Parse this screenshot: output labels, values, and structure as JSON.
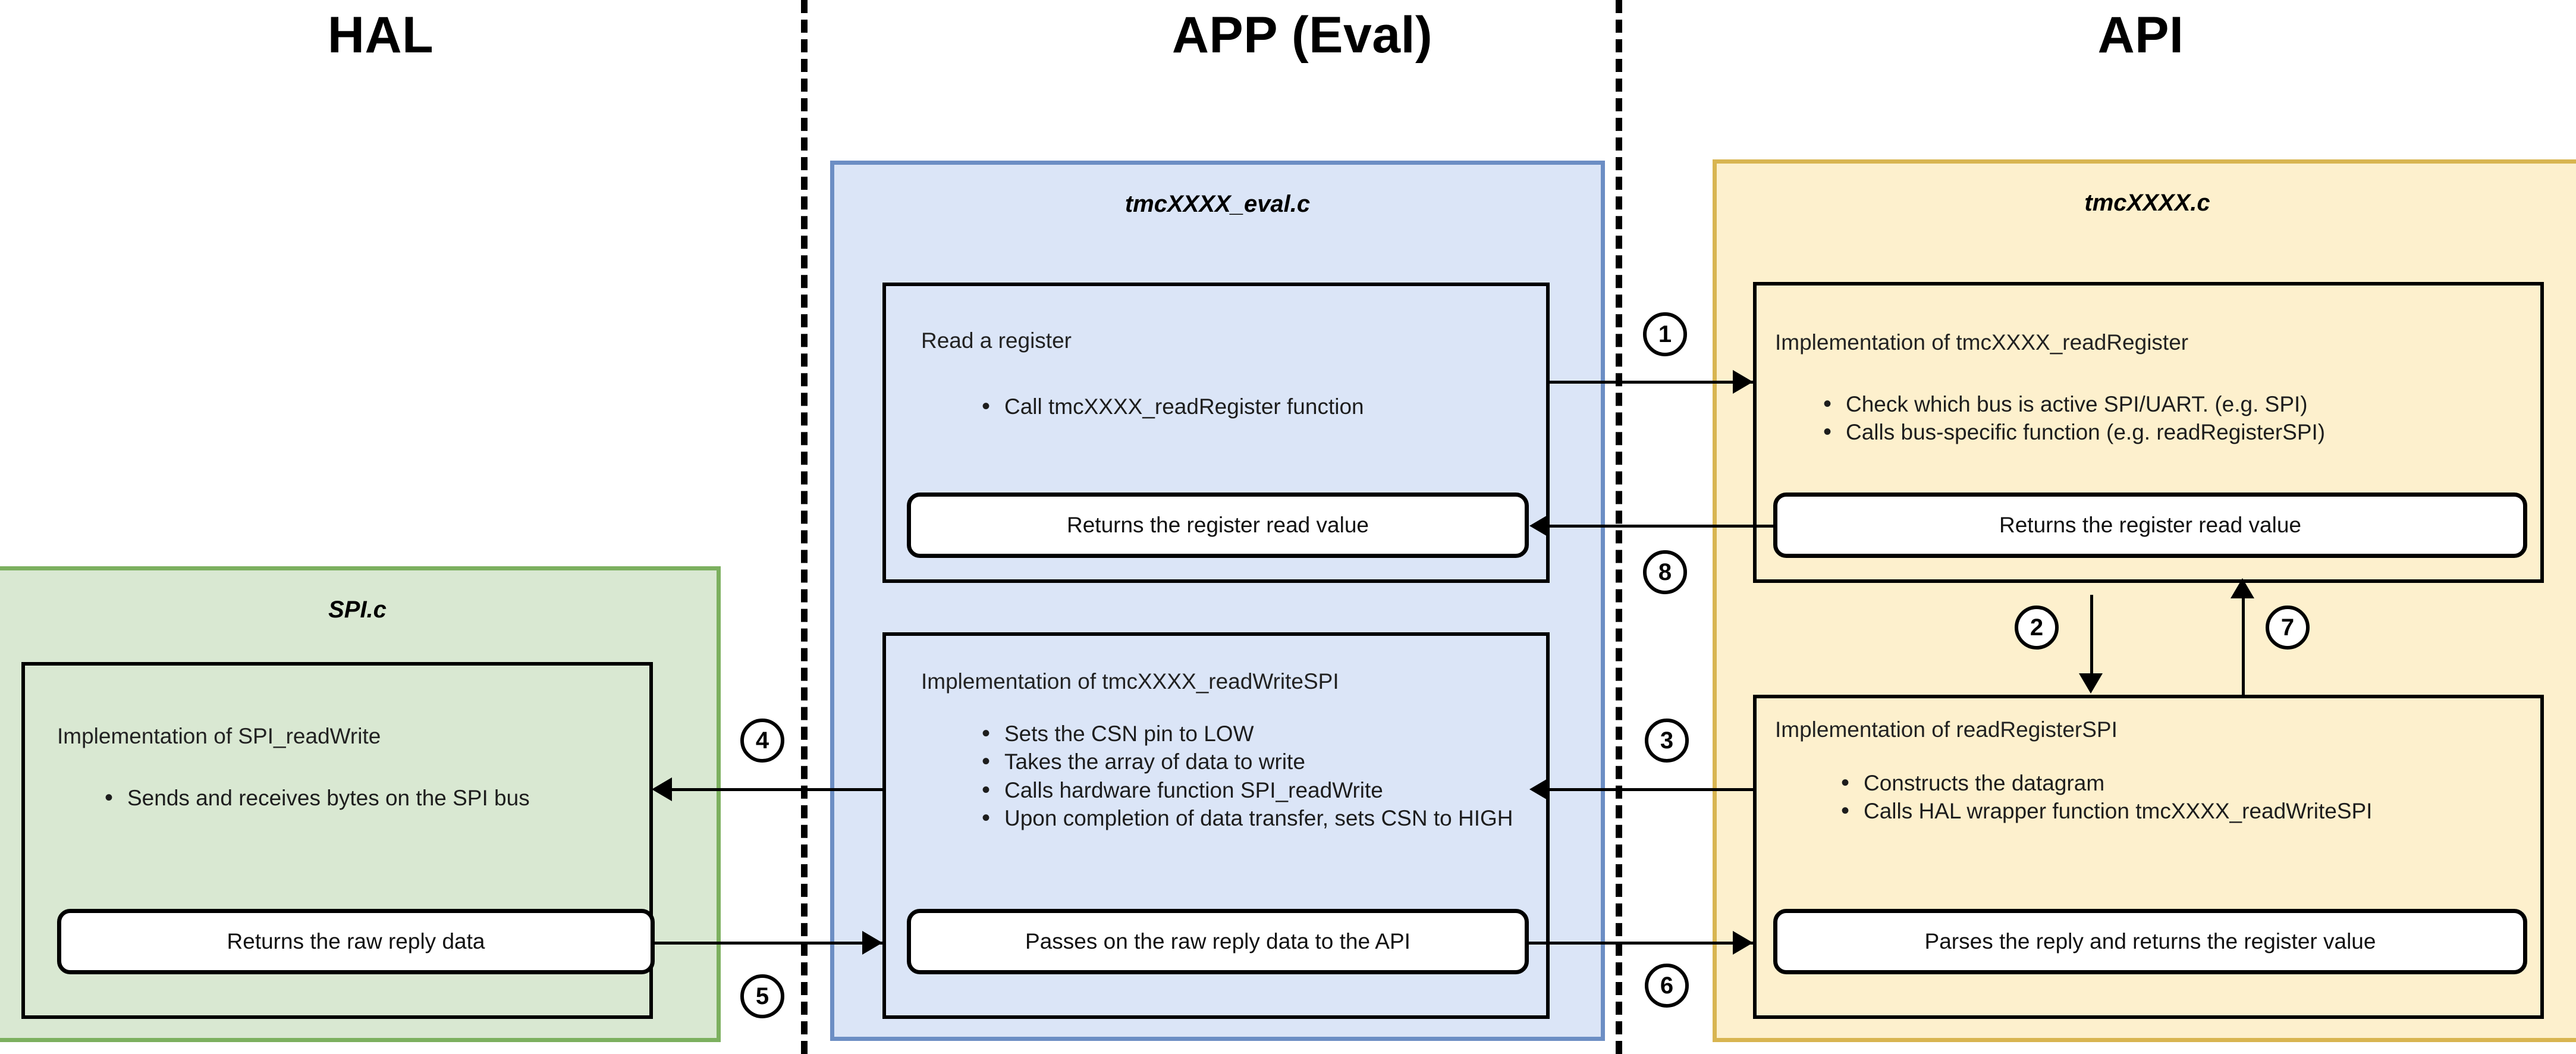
{
  "columns": [
    {
      "id": "hal",
      "title": "HAL"
    },
    {
      "id": "app",
      "title": "APP (Eval)"
    },
    {
      "id": "api",
      "title": "API"
    }
  ],
  "panels": {
    "app_eval": {
      "title": "tmcXXXX_eval.c",
      "color": "#dbe5f7",
      "border_color": "#6c8ec4"
    },
    "hal_spi": {
      "title": "SPI.c",
      "color": "#d9e8d2",
      "border_color": "#7cb05f"
    },
    "api_tmc": {
      "title": "tmcXXXX.c",
      "color": "#fdf0cd",
      "border_color": "#d8b551"
    }
  },
  "boxes": {
    "read_a_register": {
      "heading": "Read a register",
      "bullets": [
        "Call tmcXXXX_readRegister function"
      ],
      "pill": "Returns the register read value"
    },
    "tmc_readregister": {
      "heading": "Implementation of tmcXXXX_readRegister",
      "bullets": [
        "Check which bus is active SPI/UART. (e.g. SPI)",
        "Calls bus-specific function (e.g. readRegisterSPI)"
      ],
      "pill": "Returns the register read value"
    },
    "spi_readwrite": {
      "heading": "Implementation of SPI_readWrite",
      "bullets": [
        "Sends and receives bytes on the SPI bus"
      ],
      "pill": "Returns the raw reply data"
    },
    "tmc_readwritespi": {
      "heading": "Implementation of tmcXXXX_readWriteSPI",
      "bullets": [
        "Sets the CSN pin to LOW",
        "Takes the array of data to write",
        "Calls hardware function SPI_readWrite",
        "Upon completion of data transfer, sets CSN to HIGH"
      ],
      "pill": "Passes on the raw reply data to the API"
    },
    "readregisterspi": {
      "heading": "Implementation of readRegisterSPI",
      "bullets": [
        "Constructs the datagram",
        "Calls HAL wrapper function tmcXXXX_readWriteSPI"
      ],
      "pill": "Parses the reply and returns the register value"
    }
  },
  "steps": [
    {
      "id": "step-1",
      "label": "1"
    },
    {
      "id": "step-2",
      "label": "2"
    },
    {
      "id": "step-3",
      "label": "3"
    },
    {
      "id": "step-4",
      "label": "4"
    },
    {
      "id": "step-5",
      "label": "5"
    },
    {
      "id": "step-6",
      "label": "6"
    },
    {
      "id": "step-7",
      "label": "7"
    },
    {
      "id": "step-8",
      "label": "8"
    }
  ]
}
